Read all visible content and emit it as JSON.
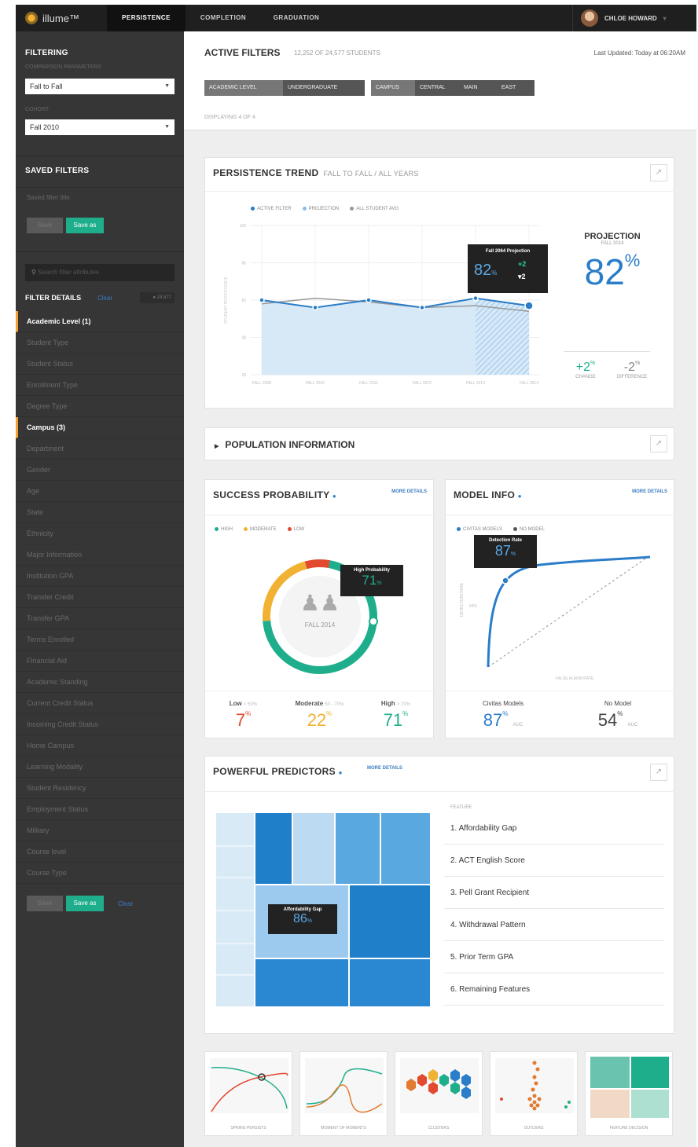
{
  "nav": {
    "logo_text": "illume™",
    "items": [
      {
        "label": "PERSISTENCE",
        "active": true
      },
      {
        "label": "COMPLETION",
        "active": false
      },
      {
        "label": "GRADUATION",
        "active": false
      }
    ],
    "user_name": "CHLOE HOWARD"
  },
  "sidebar": {
    "filtering_title": "FILTERING",
    "comparison_label": "COMPARISON PARAMETERS",
    "comparison_value": "Fall to Fall",
    "cohort_label": "COHORT",
    "cohort_value": "Fall 2010",
    "saved_filters_title": "SAVED FILTERS",
    "saved_filter_placeholder": "Saved filter title",
    "save_label": "Save",
    "save_as_label": "Save as",
    "search_placeholder": "Search filter attributes",
    "filter_details_title": "FILTER DETAILS",
    "clear_label": "Clear",
    "count_badge": "24,577",
    "items": [
      {
        "label": "Academic Level (1)",
        "highlight": true
      },
      {
        "label": "Student Type",
        "highlight": false
      },
      {
        "label": "Student Status",
        "highlight": false
      },
      {
        "label": "Enrollment Type",
        "highlight": false
      },
      {
        "label": "Degree Type",
        "highlight": false
      },
      {
        "label": "Campus (3)",
        "highlight": true
      },
      {
        "label": "Department",
        "highlight": false
      },
      {
        "label": "Gender",
        "highlight": false
      },
      {
        "label": "Age",
        "highlight": false
      },
      {
        "label": "State",
        "highlight": false
      },
      {
        "label": "Ethnicity",
        "highlight": false
      },
      {
        "label": "Major Information",
        "highlight": false
      },
      {
        "label": "Institution GPA",
        "highlight": false
      },
      {
        "label": "Transfer Credit",
        "highlight": false
      },
      {
        "label": "Transfer GPA",
        "highlight": false
      },
      {
        "label": "Terms Enrolled",
        "highlight": false
      },
      {
        "label": "Financial Aid",
        "highlight": false
      },
      {
        "label": "Academic Standing",
        "highlight": false
      },
      {
        "label": "Current Credit Status",
        "highlight": false
      },
      {
        "label": "Incoming Credit Status",
        "highlight": false
      },
      {
        "label": "Home Campus",
        "highlight": false
      },
      {
        "label": "Learning Modality",
        "highlight": false
      },
      {
        "label": "Student Residency",
        "highlight": false
      },
      {
        "label": "Employment Status",
        "highlight": false
      },
      {
        "label": "Military",
        "highlight": false
      },
      {
        "label": "Course level",
        "highlight": false
      },
      {
        "label": "Course Type",
        "highlight": false
      }
    ]
  },
  "active_filters": {
    "title": "ACTIVE FILTERS",
    "count_text": "12,252 OF 24,577 STUDENTS",
    "updated_text": "Last Updated: Today at 06:20AM",
    "displaying": "DISPLAYING 4 OF 4",
    "chips": [
      {
        "label": "ACADEMIC LEVEL",
        "dark": false
      },
      {
        "label": "UNDERGRADUATE",
        "dark": true
      },
      {
        "label": "CAMPUS",
        "dark": false
      },
      {
        "label": "CENTRAL",
        "dark": true
      },
      {
        "label": "MAIN",
        "dark": true
      },
      {
        "label": "EAST",
        "dark": true
      }
    ]
  },
  "persistence": {
    "title": "PERSISTENCE TREND",
    "subtitle": "FALL TO FALL / ALL YEARS",
    "legend": [
      "ACTIVE FILTER",
      "PROJECTION",
      "ALL STUDENT AVG"
    ],
    "ylabel": "STUDENT PERSISTENCE",
    "tooltip_title": "Fall 2064 Projection",
    "tooltip_value": "82",
    "tooltip_change": "2",
    "tooltip_diff": "2",
    "projection_title": "PROJECTION",
    "projection_sub": "FALL 2014",
    "projection_value": "82",
    "change_value": "2",
    "change_label": "CHANGE",
    "diff_value": "2",
    "diff_label": "DIFFERENCE"
  },
  "chart_data": {
    "type": "line",
    "title": "PERSISTENCE TREND",
    "x": [
      "FALL 2009",
      "FALL 2010",
      "FALL 2011",
      "FALL 2012",
      "FALL 2013",
      "FALL 2014"
    ],
    "yticks": [
      100,
      80,
      60,
      40,
      20
    ],
    "ylim": [
      20,
      100
    ],
    "series": [
      {
        "name": "ACTIVE FILTER",
        "values": [
          60,
          56,
          60,
          56,
          61,
          57
        ]
      },
      {
        "name": "ALL STUDENT AVG",
        "values": [
          58,
          61,
          59,
          56,
          57,
          54
        ]
      }
    ],
    "projection_from_index": 4
  },
  "population": {
    "title": "POPULATION INFORMATION"
  },
  "success": {
    "title": "SUCCESS PROBABILITY",
    "more_label": "MORE DETAILS",
    "legend": [
      "HIGH",
      "MODERATE",
      "LOW"
    ],
    "center_label": "FALL 2014",
    "tooltip_title": "High Probability",
    "tooltip_value": "71",
    "stats": [
      {
        "label": "Low",
        "range": "< 50%",
        "value": "7",
        "color": "#e2492f"
      },
      {
        "label": "Moderate",
        "range": "50 - 70%",
        "value": "22",
        "color": "#f1b233"
      },
      {
        "label": "High",
        "range": "> 70%",
        "value": "71",
        "color": "#1fae8c"
      }
    ],
    "donut": [
      {
        "name": "High",
        "value": 71,
        "color": "#1fae8c"
      },
      {
        "name": "Moderate",
        "value": 22,
        "color": "#f1b233"
      },
      {
        "name": "Low",
        "value": 7,
        "color": "#e2492f"
      }
    ]
  },
  "model": {
    "title": "MODEL INFO",
    "more_label": "MORE DETAILS",
    "legend": [
      "CIVITAS MODELS",
      "NO MODEL"
    ],
    "tooltip_title": "Detection Rate",
    "tooltip_value": "87",
    "ylabel": "DETECTION RATE",
    "xlabel": "FALSE ALARM RATE",
    "mid_label": "50%",
    "stats": [
      {
        "label": "Civitas Models",
        "value": "87",
        "unit": "AUC",
        "color": "#2a7dc9"
      },
      {
        "label": "No Model",
        "value": "54",
        "unit": "AUC",
        "color": "#444"
      }
    ]
  },
  "predictors": {
    "title": "POWERFUL PREDICTORS",
    "more_label": "MORE DETAILS",
    "feature_header": "FEATURE",
    "tooltip_title": "Affordability Gap",
    "tooltip_value": "86",
    "features": [
      "1. Affordability Gap",
      "2. ACT English Score",
      "3. Pell Grant Recipient",
      "4. Withdrawal Pattern",
      "5. Prior Term GPA",
      "6. Remaining Features"
    ]
  },
  "thumbs": [
    {
      "label": "SPRING PERSISTS"
    },
    {
      "label": "MOMENT OF MOMENTS"
    },
    {
      "label": "CLUSTERS"
    },
    {
      "label": "OUTLIERS"
    },
    {
      "label": "FEATURE DECISION"
    }
  ],
  "colors": {
    "accent_blue": "#2a7dc9",
    "accent_green": "#1fae8c",
    "accent_orange": "#f3a233",
    "accent_red": "#e2492f"
  }
}
